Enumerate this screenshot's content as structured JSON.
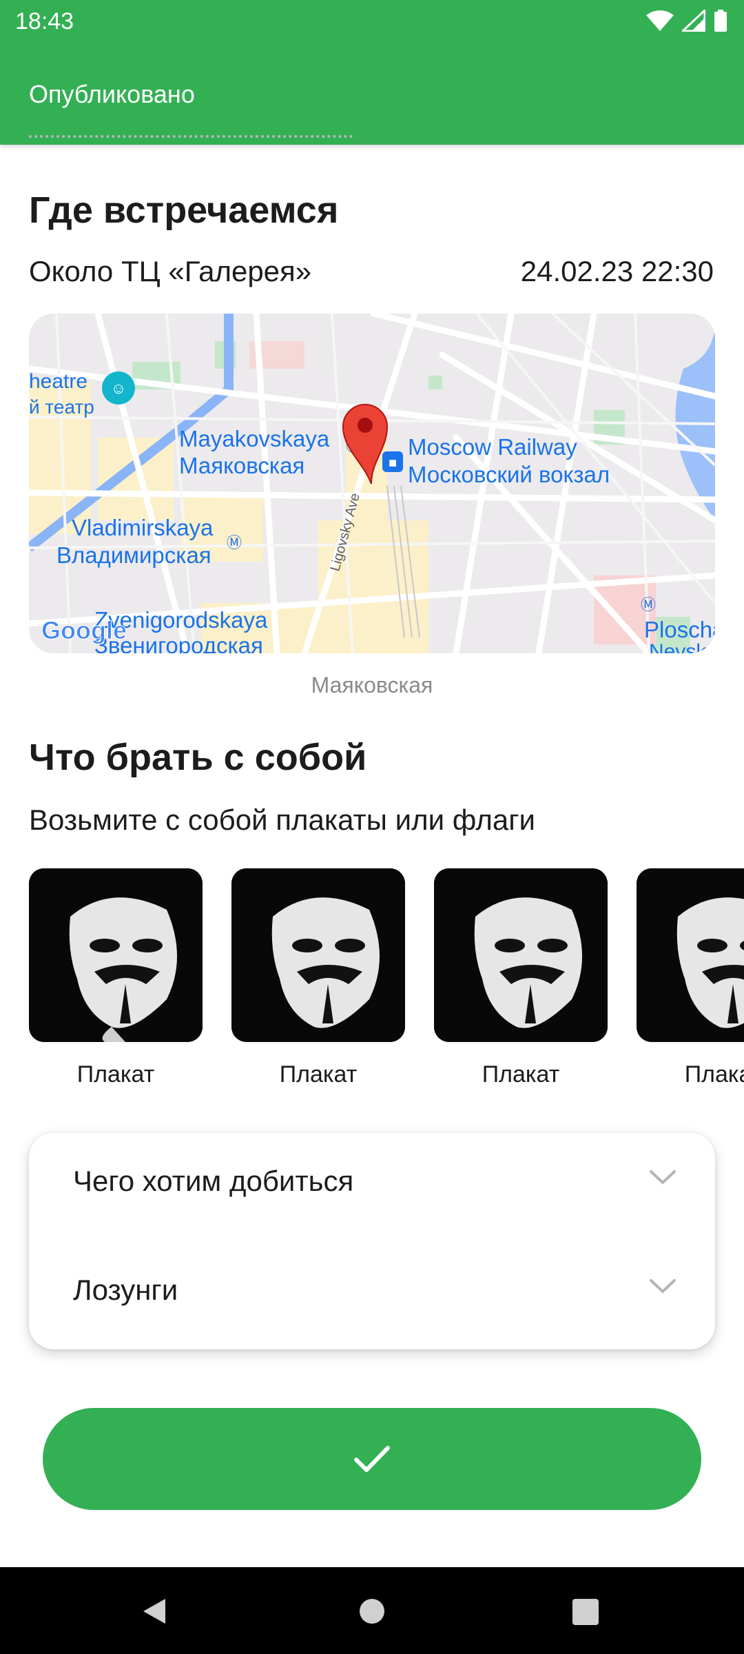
{
  "status_bar": {
    "time": "18:43"
  },
  "app_bar": {
    "title": "Опубликовано"
  },
  "meeting": {
    "heading": "Где встречаемся",
    "place": "Около ТЦ «Галерея»",
    "datetime": "24.02.23 22:30",
    "map_caption": "Маяковская",
    "map_labels": {
      "theatre_en": "heatre",
      "theatre_ru": "й театр",
      "mayak_en": "Mayakovskaya",
      "mayak_ru": "Маяковская",
      "railway_en": "Moscow Railway",
      "railway_ru": "Московский вокзал",
      "vlad_en": "Vladimirskaya",
      "vlad_ru": "Владимирская",
      "zven_en": "Zvenigorodskaya",
      "zven_ru": "Звенигородская",
      "street": "Ligovsky Ave",
      "plosch": "Ploscha",
      "nevsk": "Nevsk",
      "google": "Google"
    }
  },
  "bring": {
    "heading": "Что брать с собой",
    "description": "Возьмите с собой плакаты или флаги",
    "items": [
      {
        "label": "Плакат"
      },
      {
        "label": "Плакат"
      },
      {
        "label": "Плакат"
      },
      {
        "label": "Плакат"
      }
    ]
  },
  "accordion": {
    "goals_label": "Чего хотим добиться",
    "slogans_label": "Лозунги"
  },
  "colors": {
    "accent": "#33b054"
  }
}
